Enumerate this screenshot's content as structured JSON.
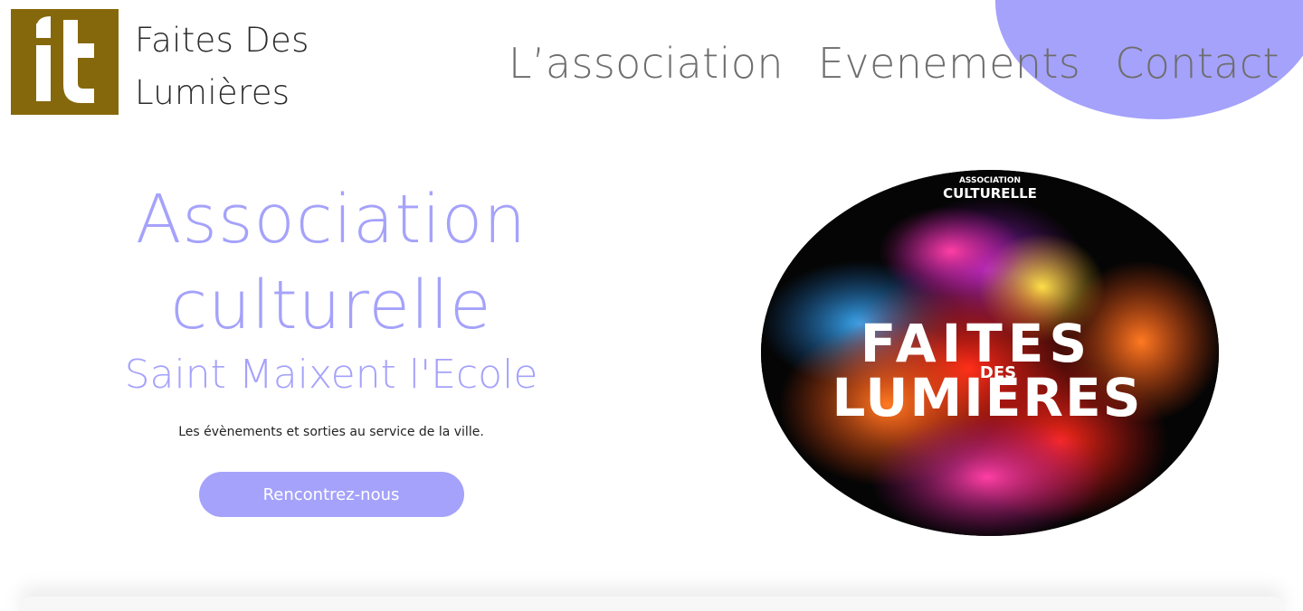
{
  "header": {
    "logo_letters": "it",
    "site_name_line1": "Faites Des",
    "site_name_line2": "Lumières",
    "logo_bg_color": "#86680c"
  },
  "nav": {
    "items": [
      {
        "label": "L’association"
      },
      {
        "label": "Evenements"
      },
      {
        "label": "Contact"
      }
    ]
  },
  "hero": {
    "title_line1": "Association",
    "title_line2": "culturelle",
    "subtitle": "Saint Maixent l'Ecole",
    "description": "Les évènements et sorties au service de la ville.",
    "cta_label": "Rencontrez-nous",
    "accent_color": "#a5a2fb"
  },
  "poster": {
    "top_small": "ASSOCIATION",
    "top_big": "CULTURELLE",
    "title_word1": "FAITES",
    "title_small": "DES",
    "title_word2": "LUMIERES"
  }
}
